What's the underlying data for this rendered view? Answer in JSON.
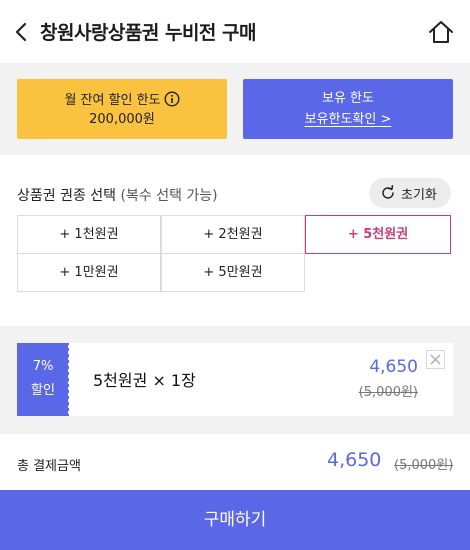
{
  "header": {
    "title": "창원사랑상품권 누비전 구매",
    "back_icon": "chevron-left-icon",
    "home_icon": "home-icon"
  },
  "limits": {
    "monthly": {
      "label": "월 잔여 할인 한도",
      "value": "200,000원",
      "icon": "info-icon"
    },
    "owned": {
      "label": "보유 한도",
      "link": "보유한도확인 >"
    }
  },
  "selection": {
    "label": "상품권 권종 선택",
    "sublabel": "(복수 선택 가능)",
    "reset_label": "초기화",
    "options": [
      "+ 1천원권",
      "+ 2천원권",
      "+ 5천원권",
      "+ 1만원권",
      "+ 5만원권"
    ],
    "selected_index": 2
  },
  "cart": {
    "discount_rate": "7%",
    "discount_label": "할인",
    "item_name": "5천원권",
    "item_qty": "× 1장",
    "price": "4,650",
    "original_price": "(5,000원)"
  },
  "total": {
    "label": "총 결제금액",
    "price": "4,650",
    "original_price": "(5,000원)"
  },
  "buy_button": "구매하기",
  "colors": {
    "accent": "#5a68e7",
    "yellow": "#f9c340",
    "selected": "#c53f78",
    "background_gray": "#f2f2f2"
  }
}
